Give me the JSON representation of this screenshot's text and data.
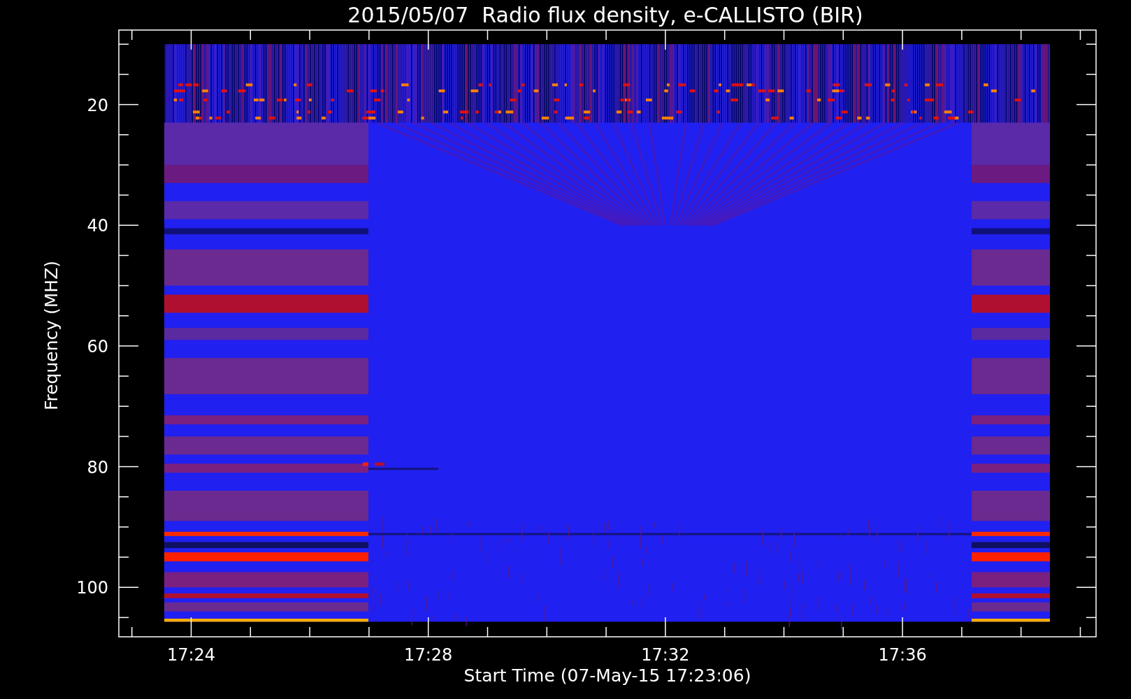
{
  "plot": {
    "title": "2015/05/07  Radio flux density, e-CALLISTO (BIR)",
    "xlabel": "Start Time (07-May-15 17:23:06)",
    "ylabel": "Frequency (MHZ)",
    "xticks": [
      "17:24",
      "17:28",
      "17:32",
      "17:36"
    ],
    "yticks": [
      "20",
      "40",
      "60",
      "80",
      "100"
    ]
  }
}
